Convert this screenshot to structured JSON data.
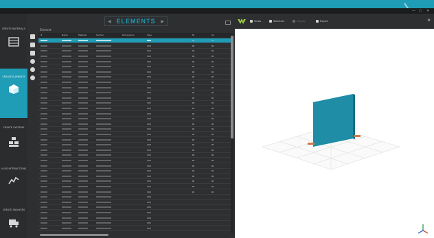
{
  "window": {
    "title": "Elements",
    "controls": [
      "—",
      "▢",
      "✕"
    ]
  },
  "nav": {
    "items": [
      {
        "label": "CREATE MATERIALS",
        "icon": "materials-icon",
        "active": false
      },
      {
        "label": "CREATE ELEMENTS",
        "icon": "cube-icon",
        "active": true
      },
      {
        "label": "CREATE SYSTEMS",
        "icon": "structure-icon",
        "active": false
      },
      {
        "label": "LOAD INTERACTIONS",
        "icon": "chart-line-icon",
        "active": false
      },
      {
        "label": "CREATE ANALYSES",
        "icon": "truck-icon",
        "active": false
      }
    ]
  },
  "panel": {
    "title": "ELEMENTS",
    "filter_label": "Element",
    "columns": [
      "#",
      "Name",
      "Material",
      "Section",
      "Dimensions",
      "Type",
      "",
      "",
      "Nr",
      "Ax"
    ]
  },
  "viewport": {
    "toolbar": [
      "Views",
      "Selection",
      "Display",
      "Export"
    ],
    "accent": "#1f9cb6"
  },
  "colors": {
    "accent": "#1f9cb6",
    "panel": "#2e2f31",
    "nav": "#2b2c2e"
  }
}
